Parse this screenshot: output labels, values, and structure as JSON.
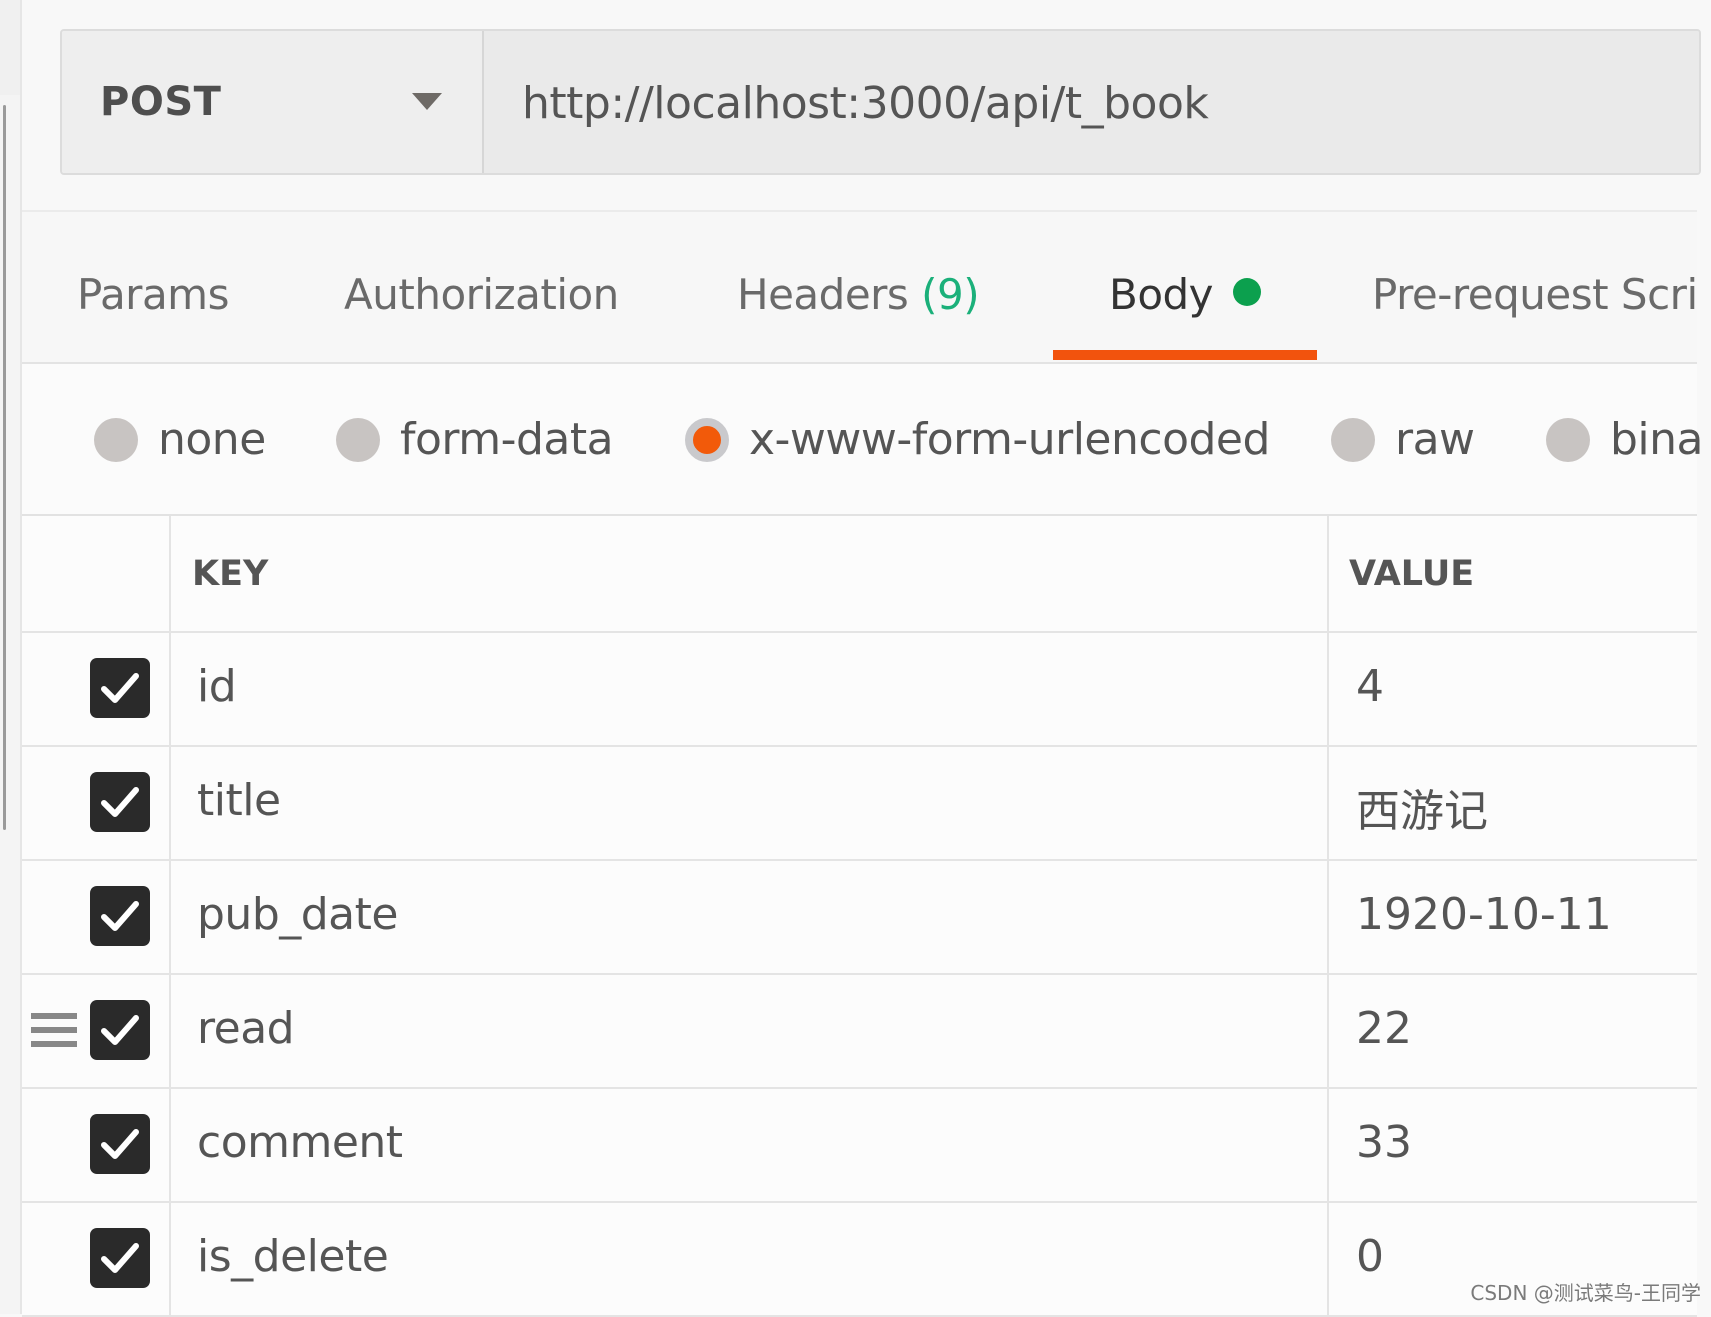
{
  "request": {
    "method": "POST",
    "url": "http://localhost:3000/api/t_book"
  },
  "tabs": [
    {
      "label": "Params"
    },
    {
      "label": "Authorization"
    },
    {
      "label": "Headers",
      "count": "(9)"
    },
    {
      "label": "Body",
      "active": true,
      "indicator": "green-dot"
    },
    {
      "label": "Pre-request Scri"
    }
  ],
  "body_types": [
    {
      "label": "none",
      "selected": false
    },
    {
      "label": "form-data",
      "selected": false
    },
    {
      "label": "x-www-form-urlencoded",
      "selected": true
    },
    {
      "label": "raw",
      "selected": false
    },
    {
      "label": "bina",
      "selected": false
    }
  ],
  "table": {
    "headers": {
      "key": "KEY",
      "value": "VALUE"
    },
    "rows": [
      {
        "key": "id",
        "value": "4",
        "checked": true
      },
      {
        "key": "title",
        "value": "西游记",
        "checked": true
      },
      {
        "key": "pub_date",
        "value": "1920-10-11",
        "checked": true
      },
      {
        "key": "read",
        "value": "22",
        "checked": true,
        "hovered": true
      },
      {
        "key": "comment",
        "value": "33",
        "checked": true
      },
      {
        "key": "is_delete",
        "value": "0",
        "checked": true
      }
    ]
  },
  "colors": {
    "accent": "#f2530d",
    "headers_count": "#1bb07a",
    "body_indicator": "#0ca04e"
  },
  "watermark": "CSDN @测试菜鸟-王同学"
}
